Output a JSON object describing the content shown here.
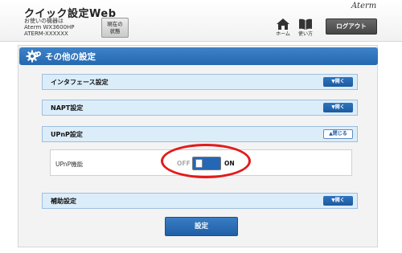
{
  "header": {
    "app_title": "クイック設定Web",
    "device_caption": "お使いの機器は",
    "device_model": "Aterm WX3600HP",
    "device_id": "ATERM-XXXXXX",
    "status_button": [
      "現在の",
      "状態"
    ],
    "brand": "Aterm",
    "home_label": "ホーム",
    "manual_label": "使い方",
    "logout_label": "ログアウト"
  },
  "page": {
    "section_title": "その他の設定"
  },
  "sections": {
    "interface": {
      "label": "インタフェース設定",
      "toggle_label": "▼開く"
    },
    "napt": {
      "label": "NAPT設定",
      "toggle_label": "▼開く"
    },
    "upnp": {
      "label": "UPnP設定",
      "toggle_label": "▲閉じる",
      "field_label": "UPnP機能",
      "off_label": "OFF",
      "on_label": "ON",
      "value": "ON"
    },
    "aux": {
      "label": "補助設定",
      "toggle_label": "▼開く"
    }
  },
  "actions": {
    "submit_label": "設定"
  },
  "colors": {
    "accent_blue": "#2468b0",
    "highlight_red": "#e21b1b",
    "section_row_bg": "#dcedfa"
  },
  "icons": [
    "home-icon",
    "book-icon",
    "gear-icon"
  ]
}
